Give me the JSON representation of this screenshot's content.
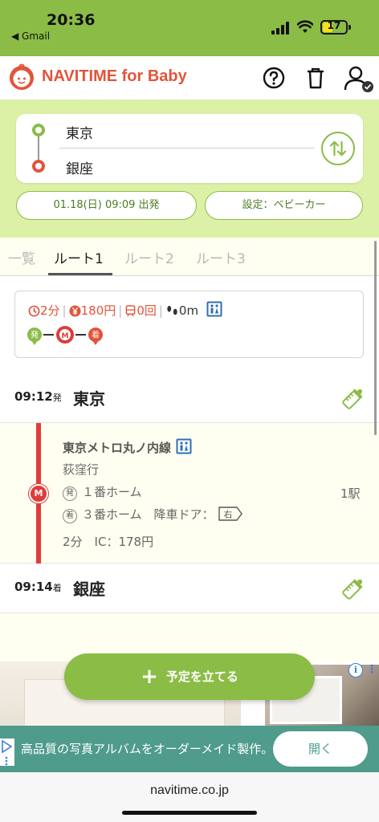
{
  "status_bar": {
    "time": "20:36",
    "back_app": "◀ Gmail",
    "battery_level": "17"
  },
  "header": {
    "logo_text": "NAVITIME for Baby"
  },
  "search": {
    "from": "東京",
    "to": "銀座",
    "datetime": "01.18(日) 09:09 出発",
    "setting": "設定：ベビーカー"
  },
  "tabs": [
    {
      "label": "一覧"
    },
    {
      "label": "ルート1"
    },
    {
      "label": "ルート2"
    },
    {
      "label": "ルート3"
    }
  ],
  "summary": {
    "time": "2分",
    "fare": "180円",
    "transfers": "0回",
    "walk": "0m",
    "mini_route": {
      "start": "発",
      "line": "M",
      "end": "着"
    }
  },
  "route": {
    "departure": {
      "time": "09:12",
      "suffix": "発",
      "station": "東京"
    },
    "segment": {
      "line_name": "東京メトロ丸ノ内線",
      "direction": "荻窪行",
      "dep_mark": "発",
      "dep_platform": "１番ホーム",
      "arr_mark": "着",
      "arr_platform": "３番ホーム　降車ドア：",
      "door": "右",
      "stops": "1駅",
      "fare": "2分　IC：178円",
      "line_mark": "M"
    },
    "arrival": {
      "time": "09:14",
      "suffix": "着",
      "station": "銀座"
    }
  },
  "fab": {
    "label": "予定を立てる",
    "icon": "+"
  },
  "ad": {
    "text": "高品質の写真アルバムをオーダーメイド製作。",
    "open_label": "開く",
    "info": "i",
    "more": "⋮"
  },
  "browser": {
    "url": "navitime.co.jp"
  },
  "colors": {
    "green": "#8bbc46",
    "light_green": "#dcf0a6",
    "orange_red": "#e1553a",
    "line_red": "#e03b3b"
  }
}
